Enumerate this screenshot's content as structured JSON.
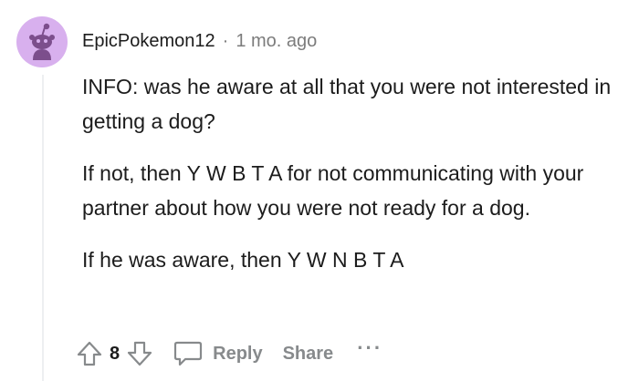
{
  "comment": {
    "author": "EpicPokemon12",
    "separator": "·",
    "time": "1 mo. ago",
    "paragraphs": [
      "INFO: was he aware at all that you were not interested in getting a dog?",
      "If not, then Y W B T A for not communicating with your partner about how you were not ready for a dog.",
      "If he was aware, then Y W N B T A"
    ]
  },
  "actions": {
    "vote_count": "8",
    "reply_label": "Reply",
    "share_label": "Share",
    "more_label": "···"
  },
  "colors": {
    "avatar_bg": "#d8b0ee",
    "avatar_figure": "#7c4e8c",
    "muted": "#878a8c",
    "text": "#1c1c1c"
  },
  "icons": [
    "snoo-avatar-icon",
    "upvote-arrow-icon",
    "downvote-arrow-icon",
    "comment-bubble-icon"
  ]
}
